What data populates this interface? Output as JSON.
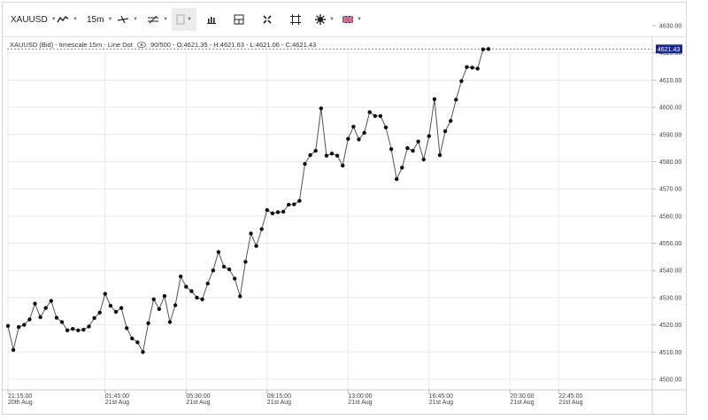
{
  "toolbar": {
    "symbol": "XAUUSD",
    "timeframe": "15m",
    "icons": [
      "line-style-icon",
      "draw-line-icon",
      "draw-fib-icon",
      "color-swatch-icon",
      "indicators-icon",
      "layout-icon",
      "fullscreen-icon",
      "crosshair-icon",
      "settings-icon",
      "flag-uk-icon"
    ]
  },
  "info_line": "XAUUSD (Bid) - timescale 15m - Line Dot",
  "info_values": "90/500 - O:4621.35 - H:4621.63 - L:4621.06 - C:4621.43",
  "colors": {
    "line": "#555555",
    "dot": "#111111",
    "price_badge": "#1a2a8a",
    "grid": "#e9e9e9"
  },
  "chart_data": {
    "type": "line",
    "title": "",
    "xlabel": "",
    "ylabel": "",
    "ylim": [
      4500,
      4630
    ],
    "y_ticks": [
      "4500.00",
      "4510.00",
      "4520.00",
      "4530.00",
      "4540.00",
      "4550.00",
      "4560.00",
      "4570.00",
      "4580.00",
      "4590.00",
      "4600.00",
      "4610.00",
      "4620.00",
      "4630.00"
    ],
    "y_tick_values": [
      4500,
      4510,
      4520,
      4530,
      4540,
      4550,
      4560,
      4570,
      4580,
      4590,
      4600,
      4610,
      4620,
      4630
    ],
    "x_ticks": [
      {
        "time": "21:15:00",
        "date": "20th Aug",
        "index": 0
      },
      {
        "time": "01:45:00",
        "date": "21st Aug",
        "index": 18
      },
      {
        "time": "05:30:00",
        "date": "21st Aug",
        "index": 33
      },
      {
        "time": "09:15:00",
        "date": "21st Aug",
        "index": 48
      },
      {
        "time": "13:00:00",
        "date": "21st Aug",
        "index": 63
      },
      {
        "time": "16:45:00",
        "date": "21st Aug",
        "index": 78
      },
      {
        "time": "20:30:00",
        "date": "21st Aug",
        "index": 93
      },
      {
        "time": "22:45:00",
        "date": "21st Aug",
        "index": 102
      }
    ],
    "current_price": "4621.43",
    "current_price_value": 4621.43,
    "values": [
      4519.6,
      4510.8,
      4519.2,
      4520,
      4522,
      4527.8,
      4522.8,
      4526.2,
      4528.8,
      4522.6,
      4521,
      4518,
      4518.5,
      4518,
      4518.2,
      4519.4,
      4522.5,
      4524.5,
      4531.4,
      4527,
      4524.8,
      4526.2,
      4518.8,
      4515,
      4513.6,
      4510,
      4520.6,
      4529.4,
      4525.8,
      4530.6,
      4521,
      4527.2,
      4537.8,
      4534,
      4532.4,
      4530,
      4529.4,
      4535.2,
      4540,
      4546.8,
      4541.4,
      4540.4,
      4537,
      4530.5,
      4543.2,
      4553.6,
      4549,
      4555.2,
      4562.2,
      4561,
      4561.4,
      4561.6,
      4564.2,
      4564.3,
      4565.6,
      4579.2,
      4582.4,
      4584,
      4599.6,
      4582.2,
      4583,
      4582.2,
      4578.6,
      4588.4,
      4592.9,
      4588.2,
      4590.6,
      4598.2,
      4596.8,
      4596.8,
      4592.6,
      4584.6,
      4573.6,
      4577.8,
      4585,
      4584,
      4587.4,
      4580.8,
      4589.4,
      4603,
      4582.4,
      4591.2,
      4595,
      4602.8,
      4609.6,
      4614.8,
      4614.6,
      4614.2,
      4621.3,
      4621.43
    ]
  }
}
